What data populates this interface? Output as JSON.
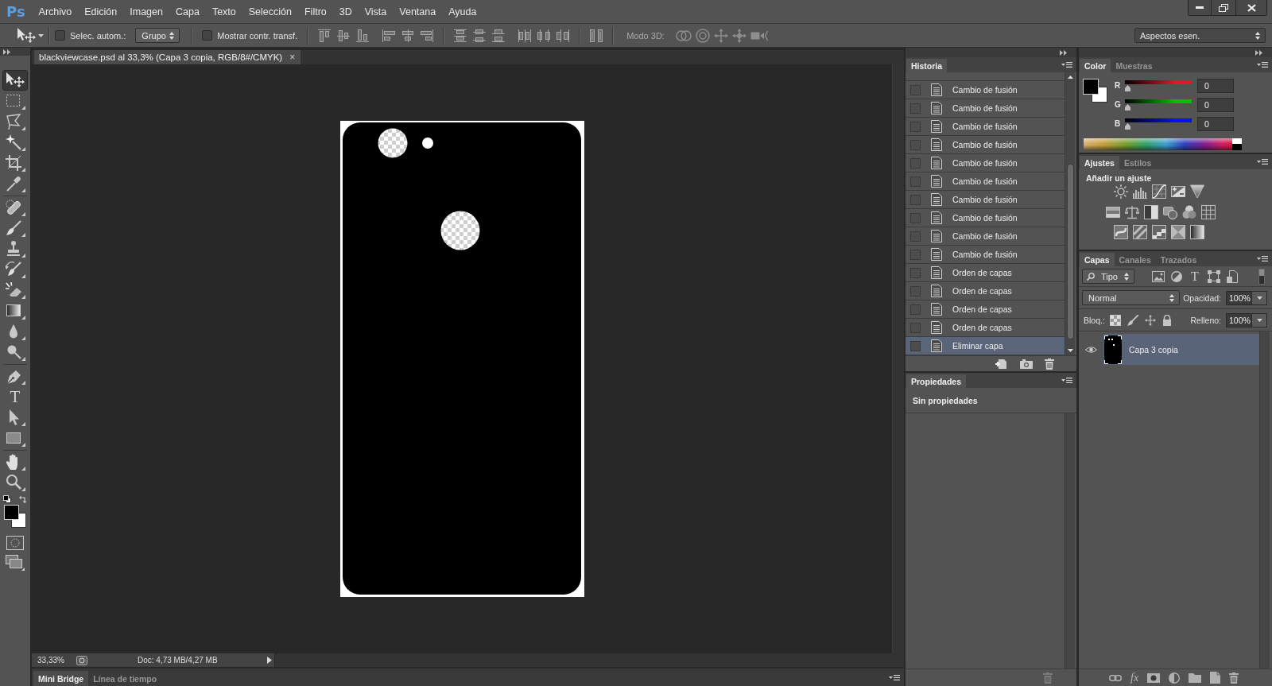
{
  "app_logo": "Ps",
  "menu": [
    "Archivo",
    "Edición",
    "Imagen",
    "Capa",
    "Texto",
    "Selección",
    "Filtro",
    "3D",
    "Vista",
    "Ventana",
    "Ayuda"
  ],
  "options_bar": {
    "auto_select": {
      "label": "Selec. autom.:",
      "checked": false
    },
    "auto_select_target": "Grupo",
    "transform_controls": {
      "label": "Mostrar contr. transf.",
      "checked": false
    },
    "mode_3d_label": "Modo 3D:",
    "workspace": "Aspectos esen."
  },
  "tool_groups": [
    [
      {
        "kind": "move",
        "selected": true
      },
      {
        "kind": "marquee",
        "selected": false
      },
      {
        "kind": "lasso",
        "selected": false
      },
      {
        "kind": "magic_wand",
        "selected": false
      },
      {
        "kind": "crop",
        "selected": false
      },
      {
        "kind": "eyedropper",
        "selected": false
      }
    ],
    [
      {
        "kind": "healing",
        "selected": false
      },
      {
        "kind": "brush",
        "selected": false
      },
      {
        "kind": "stamp",
        "selected": false
      },
      {
        "kind": "history_brush",
        "selected": false
      },
      {
        "kind": "eraser",
        "selected": false
      },
      {
        "kind": "gradient",
        "selected": false
      },
      {
        "kind": "blur",
        "selected": false
      },
      {
        "kind": "dodge",
        "selected": false
      }
    ],
    [
      {
        "kind": "pen",
        "selected": false
      },
      {
        "kind": "type",
        "glyph": "T",
        "selected": false
      },
      {
        "kind": "path_select",
        "selected": false
      },
      {
        "kind": "shape",
        "selected": false
      }
    ],
    [
      {
        "kind": "hand",
        "selected": false
      },
      {
        "kind": "zoom",
        "selected": false
      }
    ]
  ],
  "document_tab": {
    "title": "blackviewcase.psd al 33,3% (Capa 3 copia, RGB/8#/CMYK)",
    "close": "×"
  },
  "status_bar": {
    "zoom": "33,33%",
    "doc_info": "Doc: 4,73 MB/4,27 MB"
  },
  "bottom_tabs": [
    {
      "label": "Mini Bridge",
      "selected": true
    },
    {
      "label": "Línea de tiempo",
      "selected": false
    }
  ],
  "history_panel": {
    "tabs": [
      {
        "label": "Historia",
        "selected": true
      }
    ],
    "items": [
      {
        "label": "Cambio de fusión",
        "selected": false
      },
      {
        "label": "Cambio de fusión",
        "selected": false
      },
      {
        "label": "Cambio de fusión",
        "selected": false
      },
      {
        "label": "Cambio de fusión",
        "selected": false
      },
      {
        "label": "Cambio de fusión",
        "selected": false
      },
      {
        "label": "Cambio de fusión",
        "selected": false
      },
      {
        "label": "Cambio de fusión",
        "selected": false
      },
      {
        "label": "Cambio de fusión",
        "selected": false
      },
      {
        "label": "Cambio de fusión",
        "selected": false
      },
      {
        "label": "Cambio de fusión",
        "selected": false
      },
      {
        "label": "Orden de capas",
        "selected": false
      },
      {
        "label": "Orden de capas",
        "selected": false
      },
      {
        "label": "Orden de capas",
        "selected": false
      },
      {
        "label": "Orden de capas",
        "selected": false
      },
      {
        "label": "Eliminar capa",
        "selected": true
      }
    ]
  },
  "properties_panel": {
    "tabs": [
      {
        "label": "Propiedades",
        "selected": true
      }
    ],
    "message": "Sin propiedades"
  },
  "color_panel": {
    "tabs": [
      {
        "label": "Color",
        "selected": true
      },
      {
        "label": "Muestras",
        "selected": false
      }
    ],
    "channels": [
      {
        "name": "R",
        "color": "#e4152d",
        "value": "0",
        "level": 0
      },
      {
        "name": "G",
        "color": "#00c000",
        "value": "0",
        "level": 0
      },
      {
        "name": "B",
        "color": "#0a10f0",
        "value": "0",
        "level": 0
      }
    ]
  },
  "adjustments_panel": {
    "tabs": [
      {
        "label": "Ajustes",
        "selected": true
      },
      {
        "label": "Estilos",
        "selected": false
      }
    ],
    "heading": "Añadir un ajuste"
  },
  "layers_panel": {
    "tabs": [
      {
        "label": "Capas",
        "selected": true
      },
      {
        "label": "Canales",
        "selected": false
      },
      {
        "label": "Trazados",
        "selected": false
      }
    ],
    "filter_kind": "Tipo",
    "type_filter_glyph": "T",
    "filter_on": false,
    "blend_mode": "Normal",
    "opacity_label": "Opacidad:",
    "opacity": "100%",
    "lock_label": "Bloq.:",
    "fill_label": "Relleno:",
    "fill": "100%",
    "layers": [
      {
        "name": "Capa 3 copia",
        "visible": true,
        "selected": true
      }
    ],
    "style_button": "fx"
  }
}
